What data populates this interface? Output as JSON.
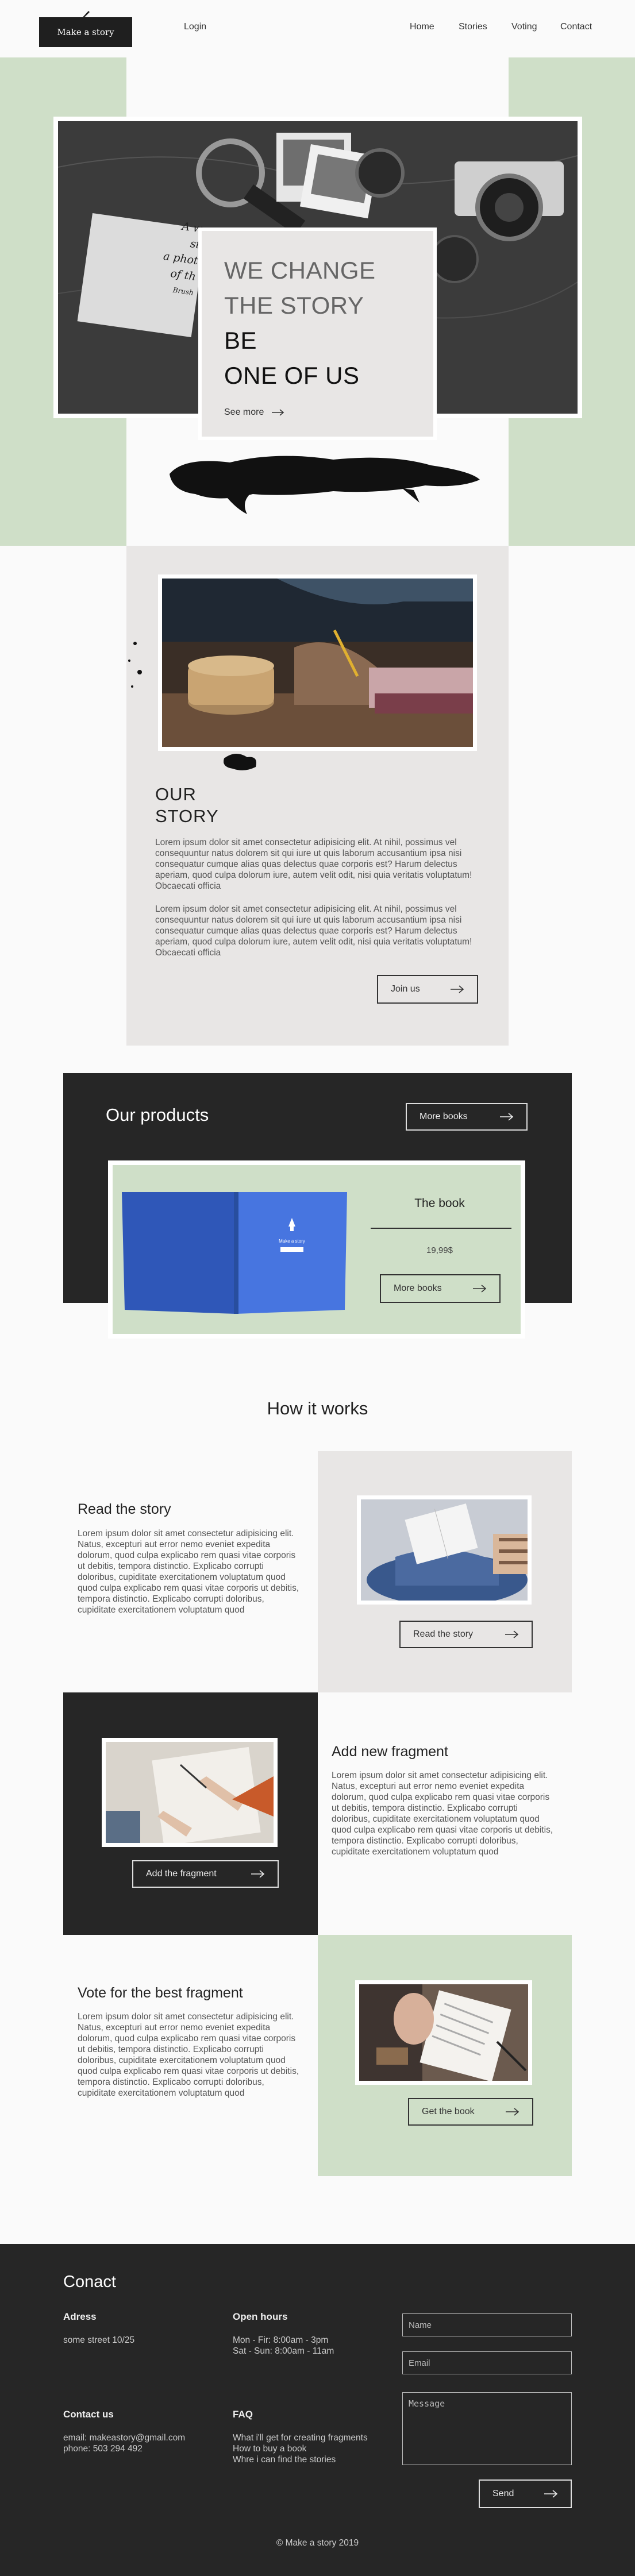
{
  "header": {
    "logo": "Make a story",
    "login": "Login",
    "nav": [
      "Home",
      "Stories",
      "Voting",
      "Contact"
    ]
  },
  "hero": {
    "line1": "WE CHANGE",
    "line2": "THE STORY",
    "line3": "BE",
    "line4": "ONE OF US",
    "see_more": "See more",
    "card_text": [
      "A w",
      "st",
      "a phot",
      "of th",
      "Brush"
    ]
  },
  "story": {
    "title_line1": "OUR",
    "title_line2": "STORY",
    "para1": "Lorem ipsum dolor sit amet consectetur adipisicing elit. At nihil, possimus vel consequuntur natus dolorem sit qui iure ut quis laborum accusantium ipsa nisi consequatur cumque alias quas delectus quae corporis est? Harum delectus aperiam, quod culpa dolorum iure, autem velit odit, nisi quia veritatis voluptatum! Obcaecati officia",
    "para2": "Lorem ipsum dolor sit amet consectetur adipisicing elit. At nihil, possimus vel consequuntur natus dolorem sit qui iure ut quis laborum accusantium ipsa nisi consequatur cumque alias quas delectus quae corporis est? Harum delectus aperiam, quod culpa dolorum iure, autem velit odit, nisi quia veritatis voluptatum! Obcaecati officia",
    "join": "Join us"
  },
  "products": {
    "title": "Our products",
    "more_top": "More books",
    "book_title": "The book",
    "price": "19,99$",
    "more_bottom": "More books",
    "cover_text": "Make a story"
  },
  "how": {
    "title": "How it works",
    "step1_title": "Read the story",
    "step1_text": "Lorem ipsum dolor sit amet consectetur adipisicing elit. Natus, excepturi aut error nemo eveniet expedita dolorum, quod culpa explicabo rem quasi vitae corporis ut debitis, tempora distinctio. Explicabo corrupti doloribus, cupiditate exercitationem voluptatum quod quod culpa explicabo rem quasi vitae corporis ut debitis, tempora distinctio. Explicabo corrupti doloribus, cupiditate exercitationem voluptatum quod",
    "step1_btn": "Read the story",
    "step2_title": "Add new fragment",
    "step2_text": "Lorem ipsum dolor sit amet consectetur adipisicing elit. Natus, excepturi aut error nemo eveniet expedita dolorum, quod culpa explicabo rem quasi vitae corporis ut debitis, tempora distinctio. Explicabo corrupti doloribus, cupiditate exercitationem voluptatum quod quod culpa explicabo rem quasi vitae corporis ut debitis, tempora distinctio. Explicabo corrupti doloribus, cupiditate exercitationem voluptatum quod",
    "step2_btn": "Add the fragment",
    "step3_title": "Vote for the best fragment",
    "step3_text": "Lorem ipsum dolor sit amet consectetur adipisicing elit. Natus, excepturi aut error nemo eveniet expedita dolorum, quod culpa explicabo rem quasi vitae corporis ut debitis, tempora distinctio. Explicabo corrupti doloribus, cupiditate exercitationem voluptatum quod quod culpa explicabo rem quasi vitae corporis ut debitis, tempora distinctio. Explicabo corrupti doloribus, cupiditate exercitationem voluptatum quod",
    "step3_btn": "Get the book"
  },
  "footer": {
    "title": "Conact",
    "address_h": "Adress",
    "address": "some street 10/25",
    "hours_h": "Open hours",
    "hours1": "Mon - Fir: 8:00am - 3pm",
    "hours2": "Sat - Sun: 8:00am - 11am",
    "contact_h": "Contact us",
    "email": "email: makeastory@gmail.com",
    "phone": "phone: 503 294 492",
    "faq_h": "FAQ",
    "faq1": "What i'll get for creating fragments",
    "faq2": "How to buy a book",
    "faq3": "Whre i can find the stories",
    "name_ph": "Name",
    "email_ph": "Email",
    "message_ph": "Message",
    "send": "Send",
    "copyright": "© Make a story 2019"
  },
  "colors": {
    "green": "#cfdfc8",
    "dark": "#262626",
    "gray": "#e8e6e5",
    "book": "#3f6ed8"
  }
}
